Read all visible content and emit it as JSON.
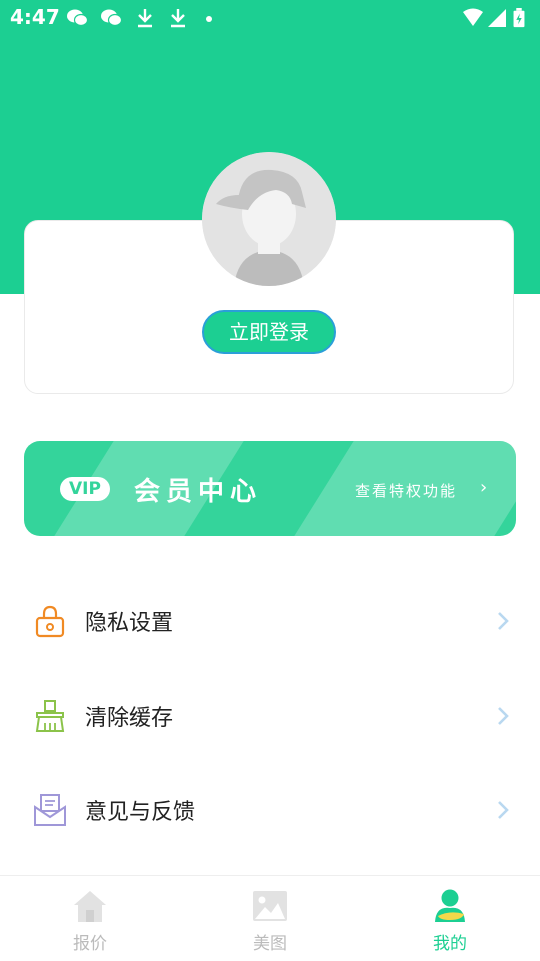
{
  "status_bar": {
    "time": "4:47"
  },
  "profile": {
    "login_label": "立即登录"
  },
  "vip": {
    "badge": "VIP",
    "title": "会员中心",
    "link": "查看特权功能",
    "chevron": "›"
  },
  "menu": [
    {
      "label": "隐私设置",
      "icon": "lock-icon"
    },
    {
      "label": "清除缓存",
      "icon": "broom-icon"
    },
    {
      "label": "意见与反馈",
      "icon": "mail-icon"
    }
  ],
  "nav": [
    {
      "label": "报价",
      "icon": "home-icon",
      "active": false
    },
    {
      "label": "美图",
      "icon": "image-icon",
      "active": false
    },
    {
      "label": "我的",
      "icon": "user-icon",
      "active": true
    }
  ],
  "colors": {
    "brand": "#1ccf92",
    "vip": "#34d49b",
    "border_accent": "#2a9fd8"
  }
}
